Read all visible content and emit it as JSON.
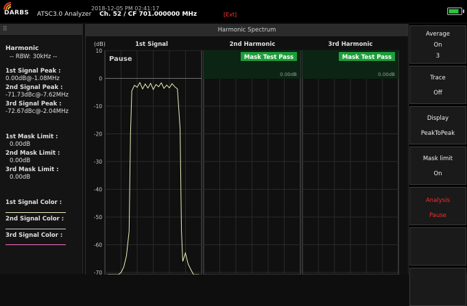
{
  "topbar": {
    "brand": "DARBS",
    "datetime": "2018-12-05 PM 02:41:17",
    "app_title": "ATSC3.0 Analyzer",
    "channel_info": "Ch. 52 / CF 701.000000 MHz",
    "exit_label": "[Ext]"
  },
  "left_panel": {
    "title": "Harmonic",
    "rbw": "-- RBW: 30kHz --",
    "peaks": [
      {
        "label": "1st Signal Peak :",
        "value": "0.00dB@-1.08MHz"
      },
      {
        "label": "2nd Signal Peak :",
        "value": "-71.73dBc@-7.62MHz"
      },
      {
        "label": "3rd Signal Peak :",
        "value": "-72.67dBc@-2.04MHz"
      }
    ],
    "mask_limits": [
      {
        "label": "1st Mask Limit :",
        "value": "0.00dB"
      },
      {
        "label": "2nd Mask Limit :",
        "value": "0.00dB"
      },
      {
        "label": "3rd Mask Limit :",
        "value": "0.00dB"
      }
    ],
    "signal_colors": [
      {
        "label": "1st Signal Color :",
        "color": "#f2f2c0"
      },
      {
        "label": "2nd Signal Color :",
        "color": "#d8d8d8"
      },
      {
        "label": "3rd Signal Color :",
        "color": "#ff6fd0"
      }
    ]
  },
  "main": {
    "title": "Harmonic Spectrum",
    "unit": "(dB)",
    "columns": [
      "1st Signal",
      "2nd Harmonic",
      "3rd Harmonic"
    ],
    "pause_label": "Pause",
    "mask_badge": "Mask Test Pass",
    "mask_value": "0.00dB"
  },
  "chart_data": {
    "type": "line",
    "ylabel": "(dB)",
    "ylim": [
      -70,
      10
    ],
    "yticks": [
      10,
      0,
      -10,
      -20,
      -30,
      -40,
      -50,
      -60,
      -70
    ],
    "series": [
      {
        "x": [
          0,
          4,
          8,
          10,
          12,
          14,
          16,
          17,
          18,
          20,
          22,
          24,
          26,
          28,
          30,
          32,
          34,
          36,
          38,
          40,
          42,
          44,
          46,
          48,
          50,
          52,
          54,
          55,
          56,
          58,
          60,
          62,
          64,
          68
        ],
        "values": [
          -76,
          -74,
          -72,
          -70,
          -68,
          -64,
          -55,
          -20,
          -4.5,
          -2.5,
          -3.2,
          -1.5,
          -3.8,
          -2.0,
          -3.5,
          -1.8,
          -4.0,
          -2.2,
          -3.0,
          -1.6,
          -3.6,
          -2.4,
          -3.4,
          -1.9,
          -3.0,
          -3.8,
          -18,
          -55,
          -66,
          -63,
          -67,
          -69,
          -72,
          -75
        ]
      }
    ]
  },
  "right_buttons": [
    {
      "line1": "Average",
      "line2": "On",
      "line3": "3",
      "accent": false
    },
    {
      "line1": "Trace",
      "line2": "Off",
      "accent": false
    },
    {
      "line1": "Display",
      "line2": "PeakToPeak",
      "accent": false
    },
    {
      "line1": "Mask limit",
      "line2": "On",
      "accent": false
    },
    {
      "line1": "Analysis",
      "line2": "Pause",
      "accent": true
    }
  ]
}
